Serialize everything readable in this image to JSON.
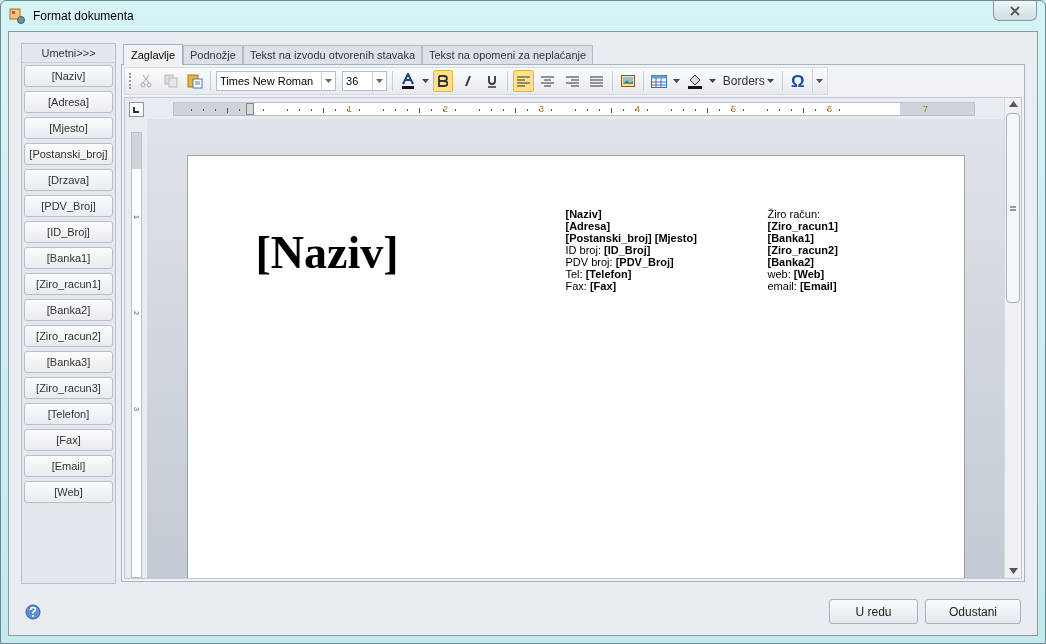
{
  "window": {
    "title": "Format dokumenta"
  },
  "insert_panel": {
    "title": "Umetni>>>",
    "items": [
      "[Naziv]",
      "[Adresa]",
      "[Mjesto]",
      "[Postanski_broj]",
      "[Drzava]",
      "[PDV_Broj]",
      "[ID_Broj]",
      "[Banka1]",
      "[Ziro_racun1]",
      "[Banka2]",
      "[Ziro_racun2]",
      "[Banka3]",
      "[Ziro_racun3]",
      "[Telefon]",
      "[Fax]",
      "[Email]",
      "[Web]"
    ]
  },
  "tabs": [
    {
      "label": "Zaglavlje",
      "selected": true
    },
    {
      "label": "Podnožje",
      "selected": false
    },
    {
      "label": "Tekst na izvodu otvorenih stavaka",
      "selected": false
    },
    {
      "label": "Tekst na opomeni za neplaćanje",
      "selected": false
    }
  ],
  "toolbar": {
    "font": "Times New Roman",
    "size": "36",
    "bold": true,
    "italic": false,
    "underline": false,
    "align_left": true,
    "borders": "Borders",
    "symbol": "Ω"
  },
  "ruler": {
    "labels": [
      "1",
      "2",
      "3",
      "4",
      "5",
      "6",
      "7"
    ],
    "vertical_labels": [
      "1",
      "2",
      "3"
    ]
  },
  "document": {
    "title": "[Naziv]",
    "left_lines": [
      {
        "text": "[Naziv]",
        "bold": true
      },
      {
        "text": "[Adresa]",
        "bold": true
      },
      {
        "text": "[Postanski_broj] [Mjesto]",
        "bold": true
      },
      {
        "text": "ID broj: **[ID_Broj]**",
        "bold": false
      },
      {
        "text": "PDV broj: **[PDV_Broj]**",
        "bold": false
      },
      {
        "text": "Tel:  **[Telefon]**",
        "bold": false
      },
      {
        "text": "Fax: **[Fax]**",
        "bold": false
      }
    ],
    "right_lines": [
      {
        "text": "Žiro račun:",
        "bold": false
      },
      {
        "text": "[Ziro_racun1]",
        "bold": true
      },
      {
        "text": "[Banka1]",
        "bold": true
      },
      {
        "text": "[Ziro_racun2]",
        "bold": true
      },
      {
        "text": "[Banka2]",
        "bold": true
      },
      {
        "text": "web: **[Web]**",
        "bold": false
      },
      {
        "text": "email: **[Email]**",
        "bold": false
      }
    ]
  },
  "buttons": [
    "U redu",
    "Odustani"
  ]
}
